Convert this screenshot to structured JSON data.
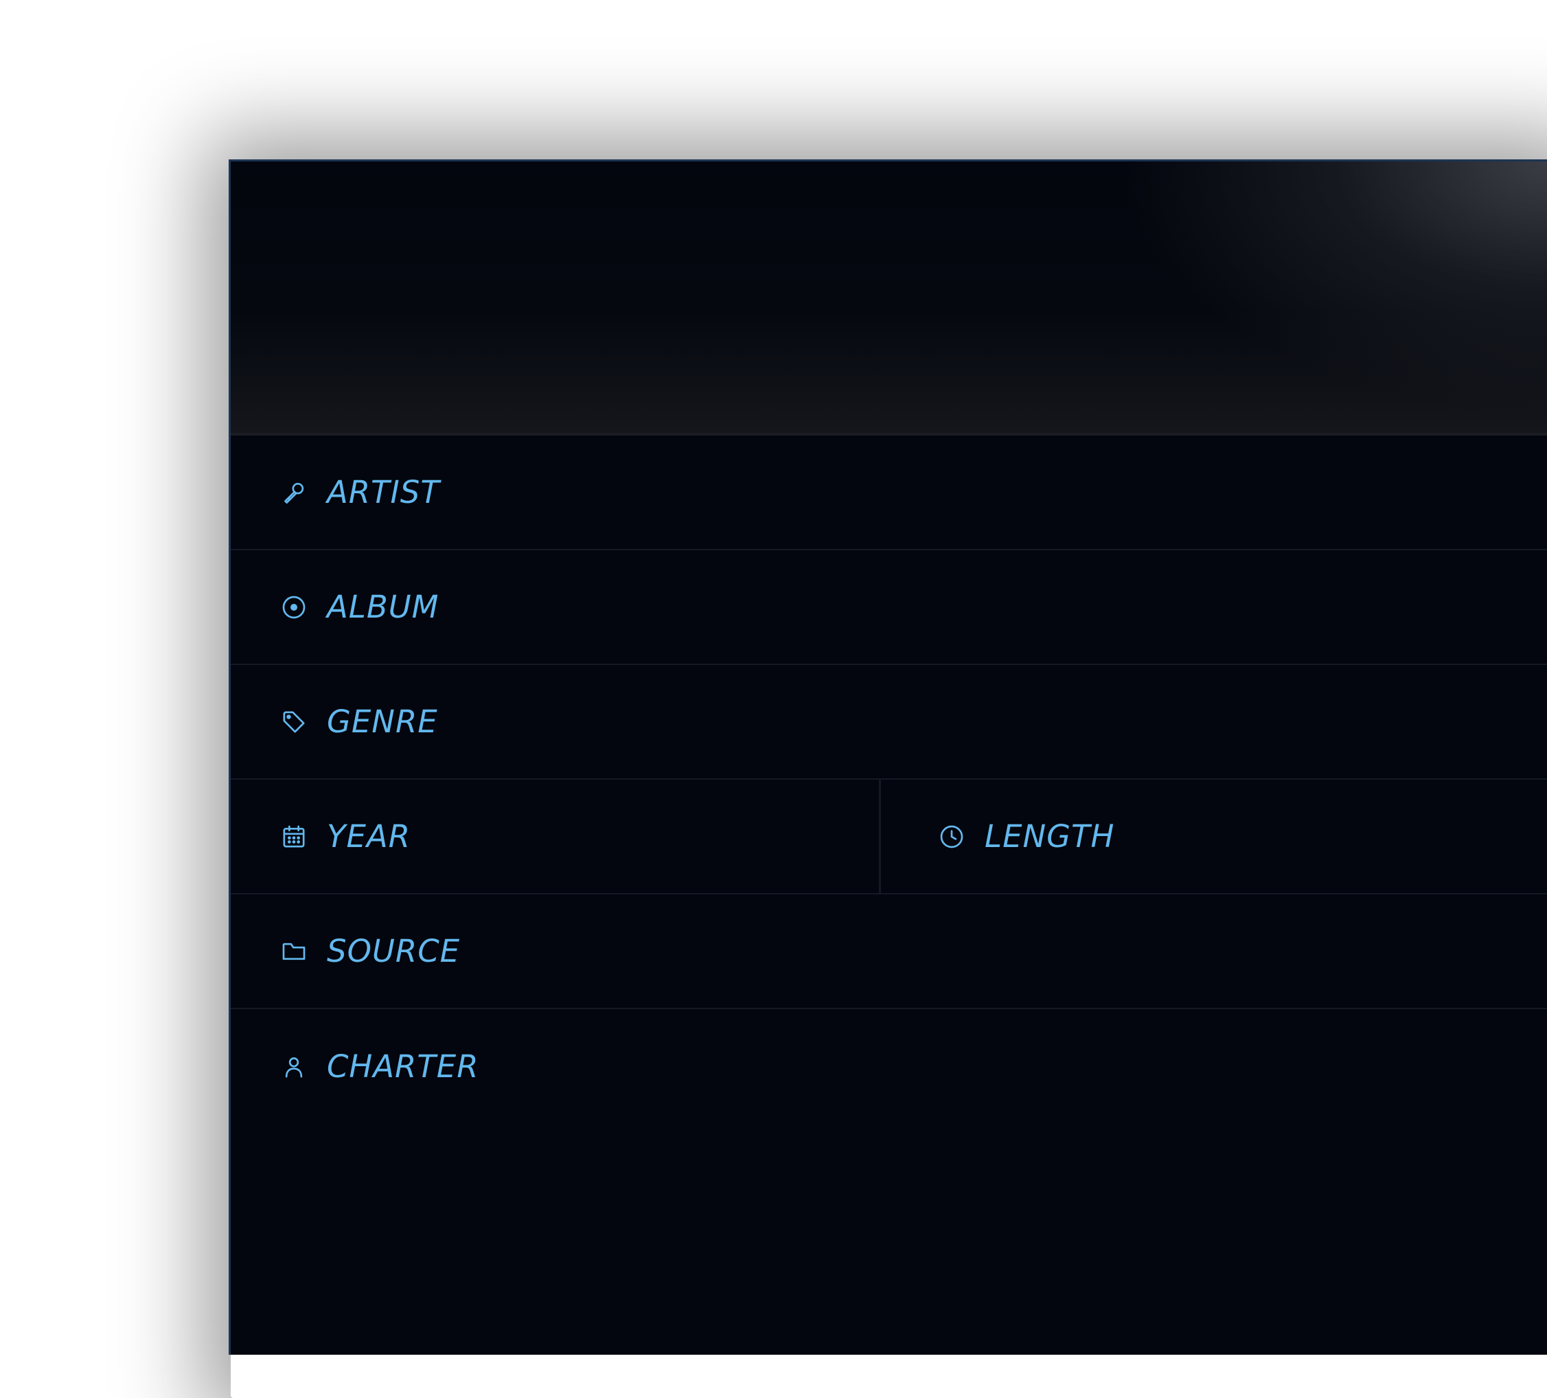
{
  "colors": {
    "background": "#03060e",
    "accent": "#63b8ee",
    "divider": "#141925",
    "frame_border": "#1d3554"
  },
  "fields": {
    "artist": {
      "label": "ARTIST",
      "icon": "microphone-icon"
    },
    "album": {
      "label": "ALBUM",
      "icon": "disc-icon"
    },
    "genre": {
      "label": "GENRE",
      "icon": "tag-icon"
    },
    "year": {
      "label": "YEAR",
      "icon": "calendar-icon"
    },
    "length": {
      "label": "LENGTH",
      "icon": "clock-icon"
    },
    "source": {
      "label": "SOURCE",
      "icon": "folder-icon"
    },
    "charter": {
      "label": "CHARTER",
      "icon": "user-icon"
    }
  }
}
